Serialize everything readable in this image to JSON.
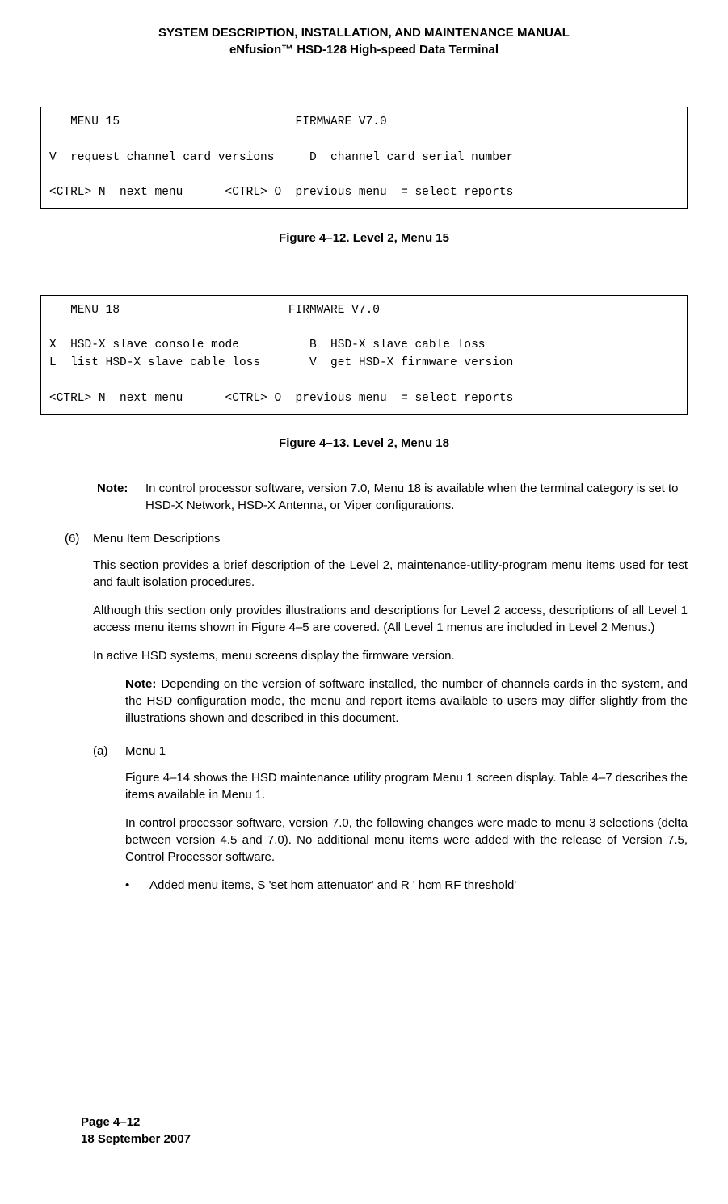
{
  "header": {
    "line1": "SYSTEM DESCRIPTION, INSTALLATION, AND MAINTENANCE MANUAL",
    "line2": "eNfusion™ HSD-128 High-speed Data Terminal"
  },
  "menu15": "   MENU 15                         FIRMWARE V7.0\n\nV  request channel card versions     D  channel card serial number\n\n<CTRL> N  next menu      <CTRL> O  previous menu  = select reports",
  "fig412": "Figure 4–12. Level 2, Menu 15",
  "menu18": "   MENU 18                        FIRMWARE V7.0\n\nX  HSD-X slave console mode          B  HSD-X slave cable loss\nL  list HSD-X slave cable loss       V  get HSD-X firmware version\n\n<CTRL> N  next menu      <CTRL> O  previous menu  = select reports",
  "fig413": "Figure 4–13. Level 2, Menu 18",
  "note1": {
    "label": "Note:",
    "text": "In control processor software, version 7.0, Menu 18 is available when the terminal category is set to HSD-X Network, HSD-X Antenna, or Viper configurations."
  },
  "section6": {
    "num": "(6)",
    "title": "Menu Item Descriptions",
    "p1": "This section provides a brief description of the Level 2, maintenance-utility-program menu items used for test and fault isolation procedures.",
    "p2": "Although this section only provides illustrations and descriptions for Level 2 access, descriptions of all Level 1 access menu items shown in Figure 4–5 are covered. (All Level 1 menus are included in Level 2 Menus.)",
    "p3": "In active HSD systems, menu screens display the firmware version."
  },
  "note2": {
    "label": "Note:",
    "text": "Depending on the version of software installed, the number of channels cards in the system, and the HSD configuration mode, the menu and report items available to users may differ slightly from the illustrations shown and described in this document."
  },
  "subA": {
    "num": "(a)",
    "title": "Menu 1",
    "p1": "Figure 4–14 shows the HSD maintenance utility program Menu 1 screen display. Table 4–7 describes the items available in Menu 1.",
    "p2": "In control processor software, version 7.0, the following changes were made to menu 3 selections (delta between version 4.5 and 7.0). No additional menu items were added with the release of Version 7.5, Control Processor software.",
    "bullet": "Added menu items, S 'set hcm attenuator' and R ' hcm RF threshold'"
  },
  "footer": {
    "page": "Page 4–12",
    "date": "18 September 2007"
  }
}
